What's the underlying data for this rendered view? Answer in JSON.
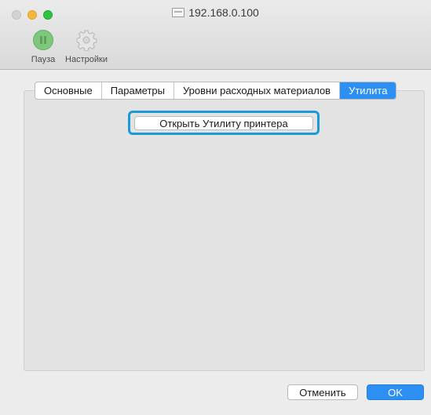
{
  "window": {
    "title": "192.168.0.100",
    "title_icon": "printer-icon"
  },
  "toolbar": {
    "pause_label": "Пауза",
    "settings_label": "Настройки"
  },
  "tabs": [
    {
      "label": "Основные",
      "active": false
    },
    {
      "label": "Параметры",
      "active": false
    },
    {
      "label": "Уровни расходных материалов",
      "active": false
    },
    {
      "label": "Утилита",
      "active": true
    }
  ],
  "main": {
    "open_utility_button": "Открыть Утилиту принтера"
  },
  "footer": {
    "cancel_label": "Отменить",
    "ok_label": "OK"
  },
  "colors": {
    "accent": "#2b8ff3",
    "highlight": "#1a9ad9",
    "pause_green": "#7fc77c"
  }
}
